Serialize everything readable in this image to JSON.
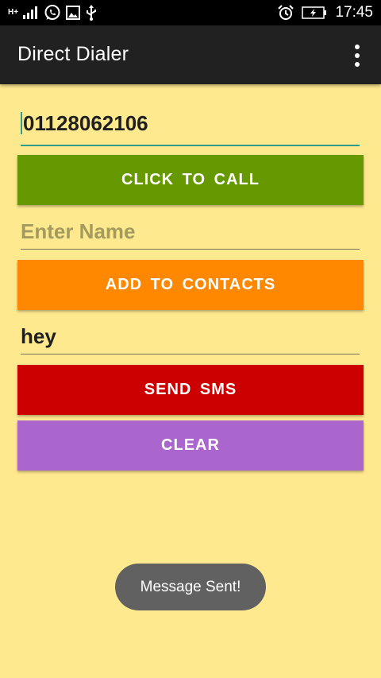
{
  "status_bar": {
    "network_type": "H+",
    "time": "17:45",
    "icons": [
      "signal-icon",
      "whatsapp-icon",
      "gallery-icon",
      "usb-icon",
      "alarm-icon",
      "battery-charging-icon"
    ]
  },
  "app_bar": {
    "title": "Direct Dialer",
    "menu_icon": "overflow-menu-icon"
  },
  "phone_field": {
    "value": "01128062106"
  },
  "name_field": {
    "value": "",
    "placeholder": "Enter Name"
  },
  "message_field": {
    "value": "hey"
  },
  "buttons": {
    "call": "CLICK TO CALL",
    "add_contact": "ADD TO CONTACTS",
    "send_sms": "SEND SMS",
    "clear": "CLEAR"
  },
  "toast": {
    "text": "Message Sent!"
  },
  "colors": {
    "background": "#FFE98E",
    "app_bar": "#212121",
    "call_button": "#669900",
    "add_contact_button": "#FF8800",
    "send_sms_button": "#CC0000",
    "clear_button": "#AA66CC",
    "accent": "#2E9E8A"
  }
}
